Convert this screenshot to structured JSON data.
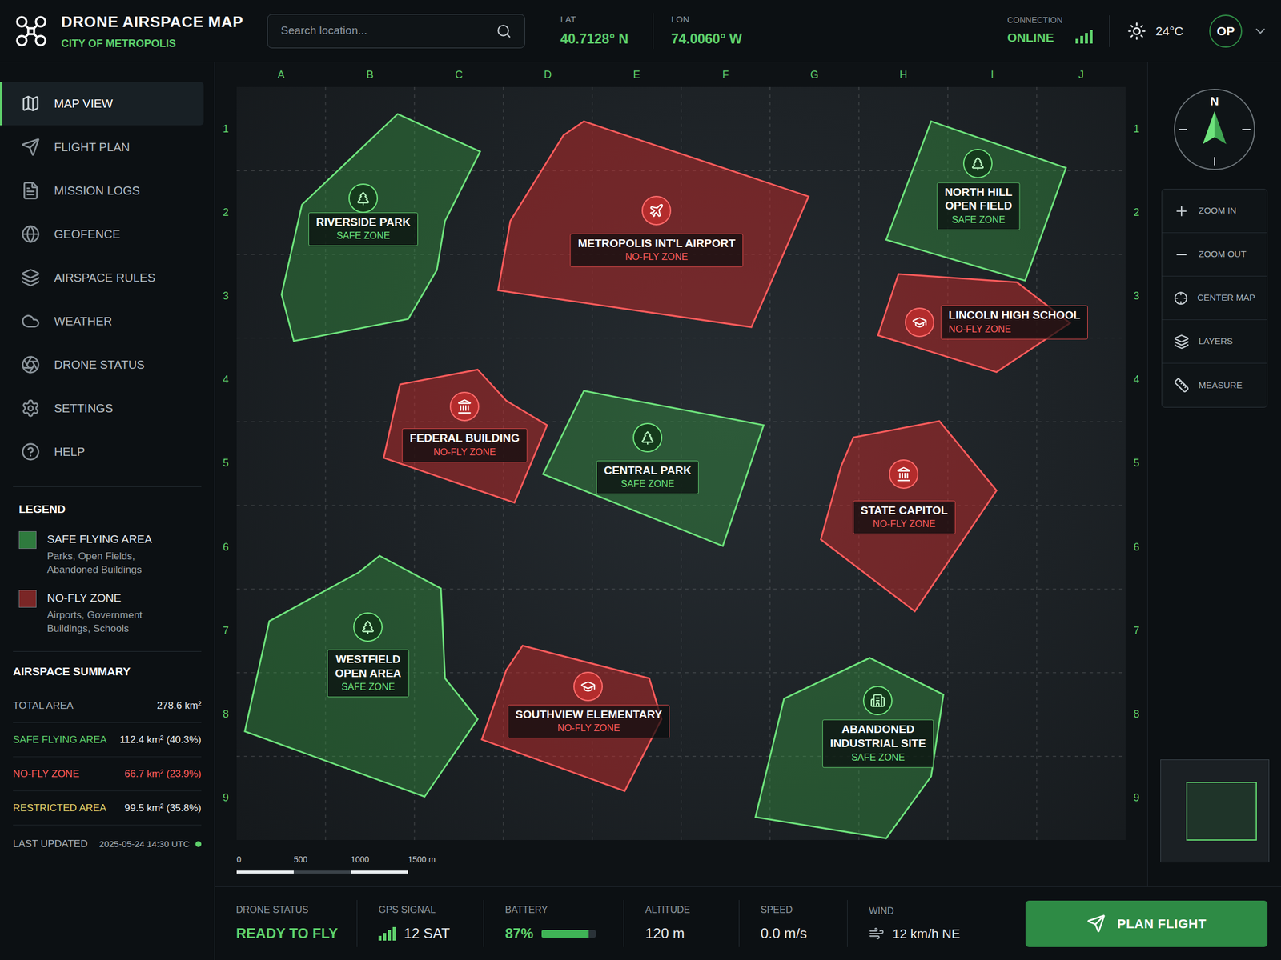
{
  "header": {
    "title": "DRONE AIRSPACE MAP",
    "subtitle": "CITY OF METROPOLIS",
    "search_placeholder": "Search location...",
    "lat": {
      "label": "LAT",
      "value": "40.7128° N"
    },
    "lon": {
      "label": "LON",
      "value": "74.0060° W"
    },
    "connection": {
      "label": "CONNECTION",
      "value": "ONLINE",
      "level": 1
    },
    "temperature": "24°C",
    "user_initials": "OP"
  },
  "sidebar": {
    "items": [
      {
        "label": "MAP VIEW",
        "selected": true
      },
      {
        "label": "FLIGHT PLAN",
        "selected": false
      },
      {
        "label": "MISSION LOGS",
        "selected": false
      },
      {
        "label": "GEOFENCE",
        "selected": false
      },
      {
        "label": "AIRSPACE RULES",
        "selected": false
      },
      {
        "label": "WEATHER",
        "selected": false
      },
      {
        "label": "DRONE STATUS",
        "selected": false
      },
      {
        "label": "SETTINGS",
        "selected": false
      },
      {
        "label": "HELP",
        "selected": false
      }
    ]
  },
  "legend": {
    "title": "LEGEND",
    "items": [
      {
        "label": "SAFE FLYING AREA",
        "description": "Parks, Open Fields,\nAbandoned Buildings",
        "color": "#2f7a3e"
      },
      {
        "label": "NO-FLY ZONE",
        "description": "Airports, Government\nBuildings, Schools",
        "color": "#7a2626"
      }
    ]
  },
  "summary": {
    "title": "AIRSPACE SUMMARY",
    "rows": [
      {
        "label": "TOTAL AREA",
        "value": "278.6 km²",
        "color": "#aab3ba",
        "value_color": "#e6eaed"
      },
      {
        "label": "SAFE FLYING AREA",
        "value": "112.4 km² (40.3%)",
        "color": "#5fd16c",
        "value_color": "#e6eaed"
      },
      {
        "label": "NO-FLY ZONE",
        "value": "66.7 km² (23.9%)",
        "color": "#ff5c5c",
        "value_color": "#ff5c5c"
      },
      {
        "label": "RESTRICTED AREA",
        "value": "99.5 km² (35.8%)",
        "color": "#e6d36a",
        "value_color": "#e6eaed"
      }
    ],
    "last_updated": {
      "label": "LAST UPDATED",
      "value": "2025-05-24 14:30 UTC",
      "online": true
    }
  },
  "map": {
    "columns": [
      "A",
      "B",
      "C",
      "D",
      "E",
      "F",
      "G",
      "H",
      "I",
      "J"
    ],
    "rows": [
      "1",
      "2",
      "3",
      "4",
      "5",
      "6",
      "7",
      "8",
      "9"
    ],
    "zones": [
      {
        "name": "RIVERSIDE PARK",
        "status": "SAFE ZONE",
        "kind": "safe"
      },
      {
        "name": "METROPOLIS INT'L AIRPORT",
        "status": "NO-FLY ZONE",
        "kind": "no-fly"
      },
      {
        "name": "NORTH HILL\nOPEN FIELD",
        "status": "SAFE ZONE",
        "kind": "safe"
      },
      {
        "name": "LINCOLN HIGH SCHOOL",
        "status": "NO-FLY ZONE",
        "kind": "no-fly"
      },
      {
        "name": "FEDERAL BUILDING",
        "status": "NO-FLY ZONE",
        "kind": "no-fly"
      },
      {
        "name": "CENTRAL PARK",
        "status": "SAFE ZONE",
        "kind": "safe"
      },
      {
        "name": "STATE CAPITOL",
        "status": "NO-FLY ZONE",
        "kind": "no-fly"
      },
      {
        "name": "WESTFIELD\nOPEN AREA",
        "status": "SAFE ZONE",
        "kind": "safe"
      },
      {
        "name": "SOUTHVIEW ELEMENTARY",
        "status": "NO-FLY ZONE",
        "kind": "no-fly"
      },
      {
        "name": "ABANDONED\nINDUSTRIAL SITE",
        "status": "SAFE ZONE",
        "kind": "safe"
      }
    ],
    "scale": [
      "0",
      "500",
      "1000",
      "1500 m"
    ]
  },
  "compass": {
    "label": "N"
  },
  "tools": [
    "ZOOM IN",
    "ZOOM OUT",
    "CENTER MAP",
    "LAYERS",
    "MEASURE"
  ],
  "status_bar": {
    "drone_status": {
      "label": "DRONE STATUS",
      "value": "READY TO FLY"
    },
    "gps": {
      "label": "GPS SIGNAL",
      "value": "12 SAT",
      "level": 1
    },
    "battery": {
      "label": "BATTERY",
      "value": "87%",
      "level": 0.87
    },
    "altitude": {
      "label": "ALTITUDE",
      "value": "120 m"
    },
    "speed": {
      "label": "SPEED",
      "value": "0.0 m/s"
    },
    "wind": {
      "label": "WIND",
      "value": "12 km/h NE"
    },
    "button": "PLAN FLIGHT"
  }
}
